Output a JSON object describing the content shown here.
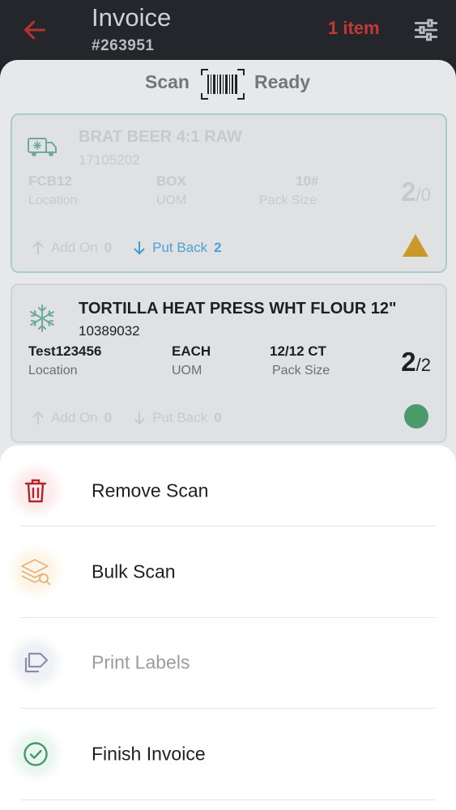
{
  "header": {
    "title": "Invoice",
    "invoice_number": "#263951",
    "item_count": "1 item"
  },
  "scan_status": {
    "left": "Scan",
    "right": "Ready"
  },
  "products": [
    {
      "name": "BRAT BEER 4:1 RAW",
      "code": "17105202",
      "location": "FCB12",
      "location_label": "Location",
      "uom": "BOX",
      "uom_label": "UOM",
      "pack_size": "10#",
      "pack_size_label": "Pack Size",
      "qty_scanned": "2",
      "qty_total": "/0",
      "add_on_label": "Add On",
      "add_on_count": "0",
      "put_back_label": "Put Back",
      "put_back_count": "2",
      "status_icon": "warning-triangle-icon"
    },
    {
      "name": "TORTILLA HEAT PRESS WHT FLOUR 12\"",
      "code": "10389032",
      "location": "Test123456",
      "location_label": "Location",
      "uom": "EACH",
      "uom_label": "UOM",
      "pack_size": "12/12 CT",
      "pack_size_label": "Pack Size",
      "qty_scanned": "2",
      "qty_total": "/2",
      "add_on_label": "Add On",
      "add_on_count": "0",
      "put_back_label": "Put Back",
      "put_back_count": "0",
      "status_icon": "complete-dot-icon"
    }
  ],
  "menu": [
    {
      "label": "Remove Scan",
      "icon": "trash-icon"
    },
    {
      "label": "Bulk Scan",
      "icon": "bulk-scan-icon"
    },
    {
      "label": "Print Labels",
      "icon": "label-icon"
    },
    {
      "label": "Finish Invoice",
      "icon": "check-circle-icon"
    }
  ],
  "colors": {
    "header_bg": "#24262c",
    "accent_red": "#c23b32",
    "put_back_blue": "#1f8fd1",
    "warning_yellow": "#d8a31b",
    "success_green": "#3f9a6a"
  }
}
